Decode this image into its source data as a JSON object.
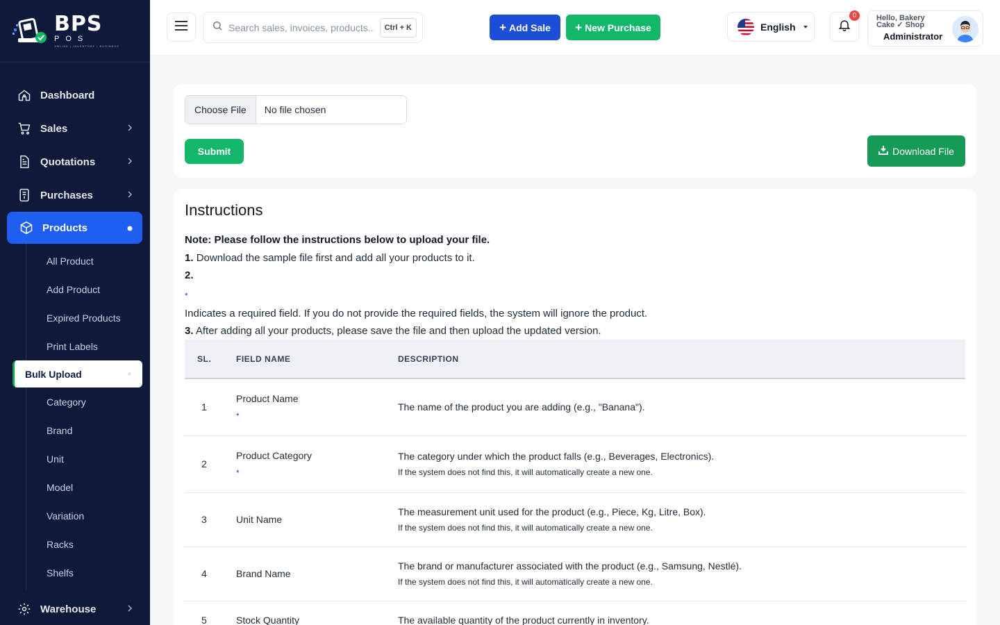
{
  "brand": {
    "logo_big": "BPS",
    "logo_small": "POS",
    "logo_tiny": "ONLINE | INVENTORY | BUSINESS"
  },
  "sidebar": {
    "items": [
      {
        "label": "Dashboard"
      },
      {
        "label": "Sales"
      },
      {
        "label": "Quotations"
      },
      {
        "label": "Purchases"
      },
      {
        "label": "Products"
      },
      {
        "label": "Warehouse"
      }
    ],
    "products_sub": [
      {
        "label": "All Product"
      },
      {
        "label": "Add Product"
      },
      {
        "label": "Expired Products"
      },
      {
        "label": "Print Labels"
      },
      {
        "label": "Bulk Upload"
      },
      {
        "label": "Category"
      },
      {
        "label": "Brand"
      },
      {
        "label": "Unit"
      },
      {
        "label": "Model"
      },
      {
        "label": "Variation"
      },
      {
        "label": "Racks"
      },
      {
        "label": "Shelfs"
      }
    ]
  },
  "header": {
    "search_placeholder": "Search sales, invoices, products...",
    "shortcut": "Ctrl + K",
    "add_sale": "Add Sale",
    "new_purchase": "New Purchase",
    "language": "English",
    "notification_count": "0",
    "user_greeting": "Hello, Bakery Cake ✓ Shop",
    "user_role": "Administrator"
  },
  "upload": {
    "choose_file": "Choose File",
    "no_file": "No file chosen",
    "submit": "Submit",
    "download": "Download File"
  },
  "instructions": {
    "title": "Instructions",
    "note_label": "Note:",
    "note_text": "Please follow the instructions below to upload your file.",
    "step1_num": "1.",
    "step1": "Download the sample file first and add all your products to it.",
    "step2_num": "2.",
    "step2_star": "*",
    "step2": "Indicates a required field. If you do not provide the required fields, the system will ignore the product.",
    "step3_num": "3.",
    "step3": "After adding all your products, please save the file and then upload the updated version."
  },
  "table": {
    "headers": {
      "sl": "SL.",
      "field": "FIELD NAME",
      "desc": "DESCRIPTION"
    },
    "rows": [
      {
        "sl": "1",
        "field": "Product Name",
        "required": "*",
        "desc": "The name of the product you are adding (e.g., \"Banana\").",
        "note": ""
      },
      {
        "sl": "2",
        "field": "Product Category",
        "required": "*",
        "desc": "The category under which the product falls (e.g., Beverages, Electronics).",
        "note": "If the system does not find this, it will automatically create a new one."
      },
      {
        "sl": "3",
        "field": "Unit Name",
        "required": "",
        "desc": "The measurement unit used for the product (e.g., Piece, Kg, Litre, Box).",
        "note": "If the system does not find this, it will automatically create a new one."
      },
      {
        "sl": "4",
        "field": "Brand Name",
        "required": "",
        "desc": "The brand or manufacturer associated with the product (e.g., Samsung, Nestlé).",
        "note": "If the system does not find this, it will automatically create a new one."
      },
      {
        "sl": "5",
        "field": "Stock Quantity",
        "required": "",
        "desc": "The available quantity of the product currently in inventory.",
        "note": ""
      }
    ]
  }
}
